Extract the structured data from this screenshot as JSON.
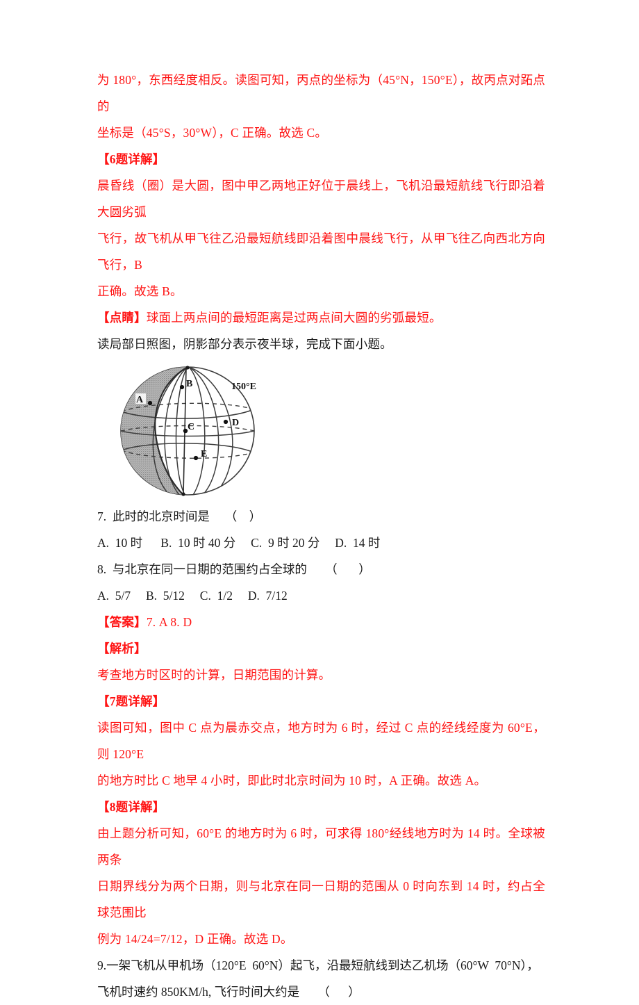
{
  "document": {
    "language": "zh-CN",
    "text_color_analysis": "#ff1414",
    "text_color_question": "#1a1a1a",
    "background": "#ffffff"
  },
  "blocks": {
    "b1_line1": "为 180°，东西经度相反。读图可知，丙点的坐标为（45°N，150°E），故丙点对跖点的",
    "b1_line2": "坐标是（45°S，30°W），C 正确。故选 C。",
    "b2_heading": "【6题详解】",
    "b2_line1": "晨昏线（圈）是大圆，图中甲乙两地正好位于晨线上，飞机沿最短航线飞行即沿着大圆劣弧",
    "b2_line2": "飞行，故飞机从甲飞往乙沿最短航线即沿着图中晨线飞行，从甲飞往乙向西北方向飞行，B",
    "b2_line3": "正确。故选 B。",
    "b3_dianjing_label": "【点睛】",
    "b3_dianjing_text": "球面上两点间的最短距离是过两点间大圆的劣弧最短。",
    "b4_intro": "读局部日照图，阴影部分表示夜半球，完成下面小题。",
    "q7_stem": "7.  此时的北京时间是     （    ）",
    "q7_options": "A.  10 时      B.  10 时 40 分     C.  9 时 20 分     D.  14 时",
    "q8_stem": "8.  与北京在同一日期的范围约占全球的      （       ）",
    "q8_options": "A.  5/7     B.  5/12     C.  1/2     D.  7/12",
    "b5_answer_label": "【答案】",
    "b5_answer_values": "7. A        8. D",
    "b6_jiexi_label": "【解析】",
    "b6_jiexi_text": "考查地方时区时的计算，日期范围的计算。",
    "b7_q7_detail_heading": "【7题详解】",
    "b7_q7_line1": "读图可知，图中 C 点为晨赤交点，地方时为 6 时，经过 C 点的经线经度为 60°E，则 120°E",
    "b7_q7_line2": "的地方时比 C 地早 4 小时，即此时北京时间为 10 时，A 正确。故选 A。",
    "b8_q8_detail_heading": "【8题详解】",
    "b8_q8_line1": "由上题分析可知，60°E 的地方时为 6 时，可求得 180°经线地方时为 14 时。全球被两条",
    "b8_q8_line2": "日期界线分为两个日期，则与北京在同一日期的范围从 0 时向东到 14 时，约占全球范围比",
    "b8_q8_line3": "例为 14/24=7/12，D 正确。故选 D。",
    "q9_line1": "9.一架飞机从甲机场（120°E  60°N）起飞，沿最短航线到达乙机场（60°W  70°N），",
    "q9_line2": "飞机时速约 850KM/h, 飞行时间大约是      （      ）"
  },
  "figure": {
    "name": "partial-sunlight-globe-diagram",
    "description": "局部日照图：阴影部分表示夜半球",
    "meridian_label": "150°E",
    "points": [
      "A",
      "B",
      "C",
      "D",
      "E"
    ],
    "shaded_region_label": "夜半球",
    "shade_color": "#9d9d9d",
    "line_color": "#3c3c3c"
  }
}
